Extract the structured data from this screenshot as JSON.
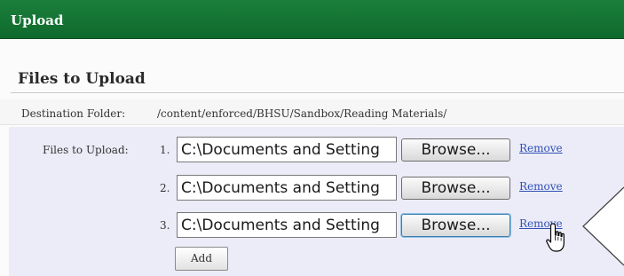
{
  "header": {
    "title": "Upload"
  },
  "section": {
    "title": "Files to Upload"
  },
  "destination": {
    "label": "Destination Folder:",
    "path": "/content/enforced/BHSU/Sandbox/Reading Materials/"
  },
  "files": {
    "label": "Files to Upload:",
    "rows": [
      {
        "number": "1.",
        "value": "C:\\Documents and Setting",
        "browse_label": "Browse...",
        "remove_label": "Remove"
      },
      {
        "number": "2.",
        "value": "C:\\Documents and Setting",
        "browse_label": "Browse...",
        "remove_label": "Remove"
      },
      {
        "number": "3.",
        "value": "C:\\Documents and Setting",
        "browse_label": "Browse...",
        "remove_label": "Remove"
      }
    ],
    "add_label": "Add"
  },
  "icons": {
    "cursor": "hand-pointer-icon",
    "callout": "callout-arrow-icon"
  },
  "colors": {
    "header_bg": "#117033",
    "link": "#2e4fb5",
    "panel_bg": "#ececf8"
  }
}
